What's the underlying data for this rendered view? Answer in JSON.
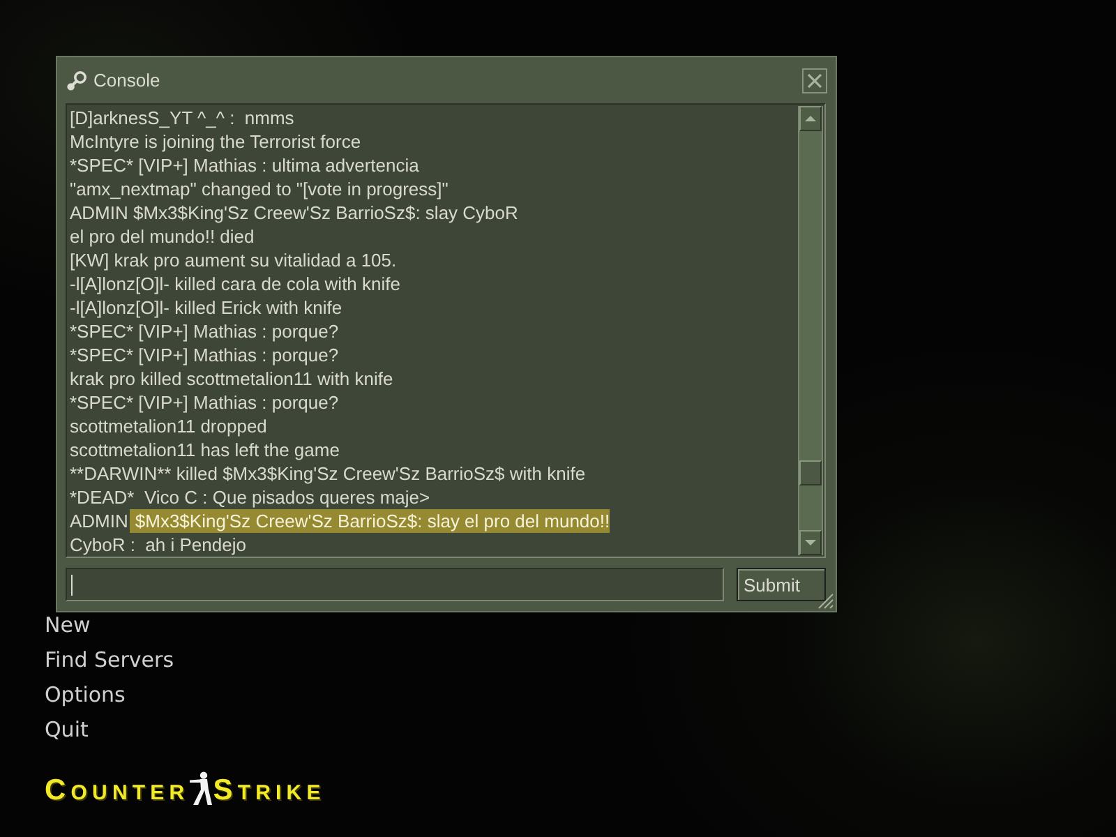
{
  "menu": {
    "items": [
      {
        "label": "New"
      },
      {
        "label": "Find Servers"
      },
      {
        "label": "Options"
      },
      {
        "label": "Quit"
      }
    ]
  },
  "logo": {
    "left": "COUNTER",
    "right": "STRIKE"
  },
  "console": {
    "title": "Console",
    "lines": [
      {
        "text": "[D]arknesS_YT ^_^ :  nmms"
      },
      {
        "text": "McIntyre is joining the Terrorist force"
      },
      {
        "text": "*SPEC* [VIP+] Mathias : ultima advertencia"
      },
      {
        "text": "\"amx_nextmap\" changed to \"[vote in progress]\""
      },
      {
        "text": "ADMIN $Mx3$King'Sz Creew'Sz BarrioSz$: slay CyboR"
      },
      {
        "text": "el pro del mundo!! died"
      },
      {
        "text": "[KW] krak pro aument su vitalidad a 105."
      },
      {
        "text": "-l[A]lonz[O]l- killed cara de cola with knife"
      },
      {
        "text": "-l[A]lonz[O]l- killed Erick with knife"
      },
      {
        "text": "*SPEC* [VIP+] Mathias : porque?"
      },
      {
        "text": "*SPEC* [VIP+] Mathias : porque?"
      },
      {
        "text": "krak pro killed scottmetalion11 with knife"
      },
      {
        "text": "*SPEC* [VIP+] Mathias : porque?"
      },
      {
        "text": "scottmetalion11 dropped"
      },
      {
        "text": "scottmetalion11 has left the game"
      },
      {
        "text": "**DARWIN** killed $Mx3$King'Sz Creew'Sz BarrioSz$ with knife"
      },
      {
        "text": "*DEAD*  Vico C : Que pisados queres maje>"
      },
      {
        "text": "ADMIN",
        "highlight": "$Mx3$King'Sz Creew'Sz BarrioSz$: slay el pro del mundo!!"
      },
      {
        "text": "CyboR :  ah i Pendejo"
      }
    ],
    "submit_label": "Submit"
  }
}
